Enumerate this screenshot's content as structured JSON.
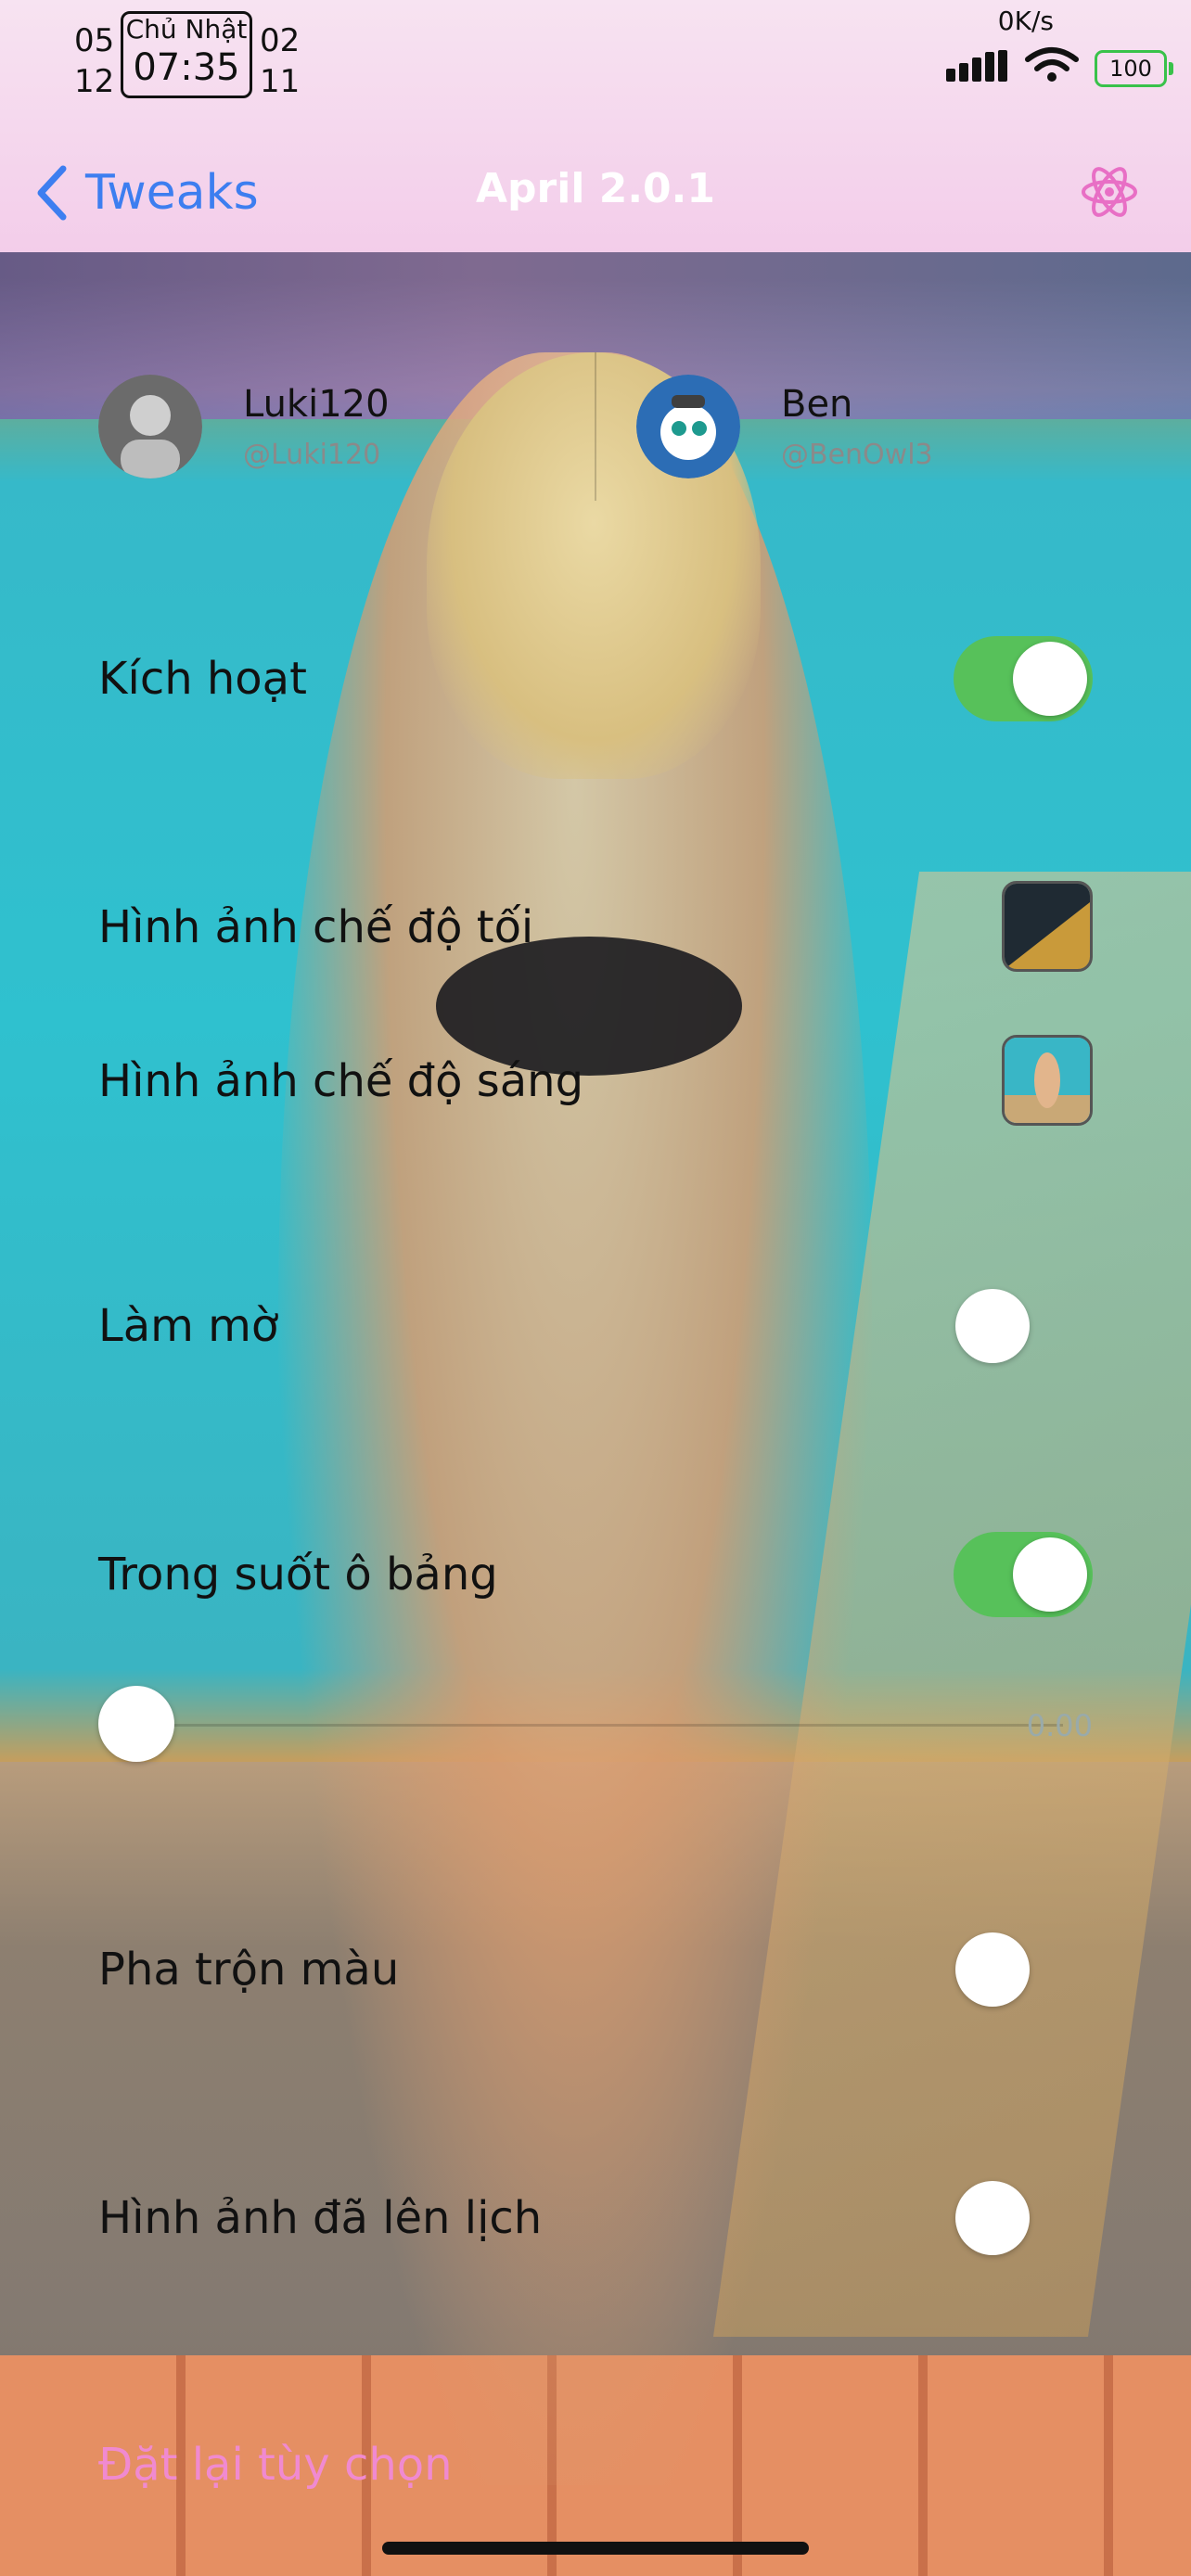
{
  "status_bar": {
    "left_top": "05",
    "left_bottom": "12",
    "day": "Chủ Nhật",
    "time": "07:35",
    "right_top": "02",
    "right_bottom": "11",
    "net_speed": "0K/s",
    "battery": "100"
  },
  "nav": {
    "back_label": "Tweaks",
    "title": "April 2.0.1",
    "accent": "#3d7ef0",
    "icon": "atom-icon"
  },
  "credits": [
    {
      "name": "Luki120",
      "handle": "@Luki120"
    },
    {
      "name": "Ben",
      "handle": "@BenOwl3"
    }
  ],
  "settings": {
    "enable_label": "Kích hoạt",
    "enable_on": true,
    "dark_image_label": "Hình ảnh chế độ tối",
    "light_image_label": "Hình ảnh chế độ sáng",
    "blur_label": "Làm mờ",
    "blur_on": false,
    "cell_transparency_label": "Trong suốt ô bảng",
    "cell_transparency_on": true,
    "slider_value": "0.00",
    "color_blend_label": "Pha trộn màu",
    "color_blend_on": false,
    "scheduled_image_label": "Hình ảnh đã lên lịch",
    "scheduled_image_on": false,
    "toggle_on_color": "#57c15a"
  },
  "reset_label": "Đặt lại tùy chọn",
  "reset_color": "#f08ad0"
}
